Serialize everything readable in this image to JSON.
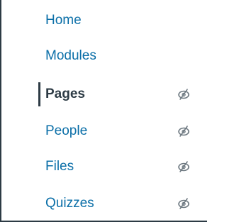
{
  "nav": {
    "items": [
      {
        "label": "Home",
        "active": false,
        "hidden_icon": false
      },
      {
        "label": "Modules",
        "active": false,
        "hidden_icon": false
      },
      {
        "label": "Pages",
        "active": true,
        "hidden_icon": true
      },
      {
        "label": "People",
        "active": false,
        "hidden_icon": true
      },
      {
        "label": "Files",
        "active": false,
        "hidden_icon": true
      },
      {
        "label": "Quizzes",
        "active": false,
        "hidden_icon": true
      }
    ],
    "icon": "eye-slash-icon",
    "colors": {
      "link": "#0b6fa8",
      "active_text": "#2d3b45",
      "border": "#2d3b45",
      "icon": "#6f7a82"
    }
  }
}
